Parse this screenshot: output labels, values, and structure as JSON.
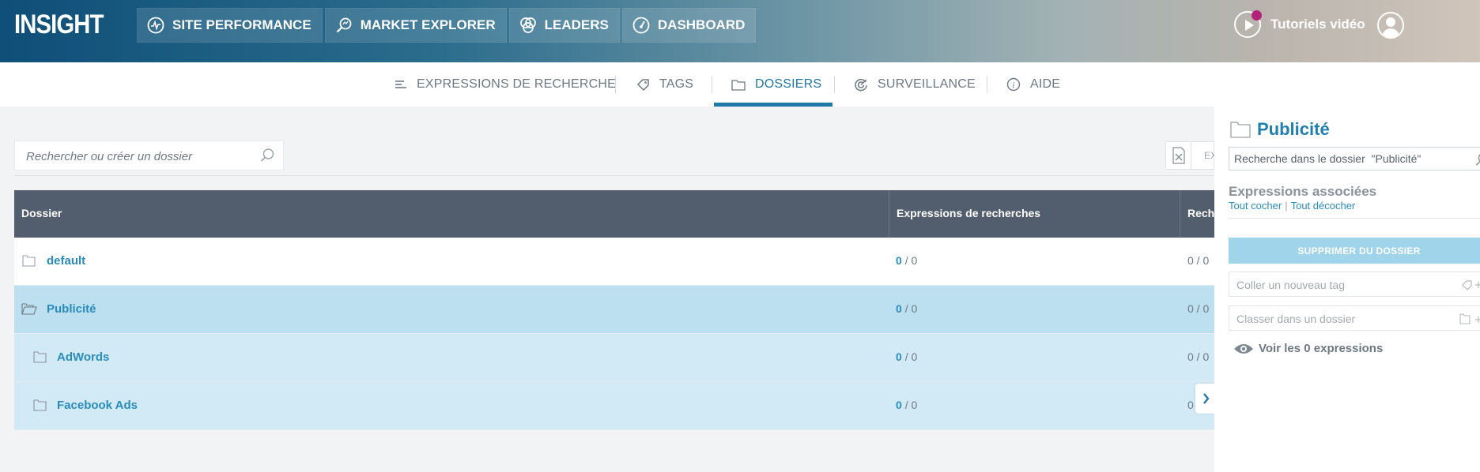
{
  "app": {
    "logo": "INSIGHT"
  },
  "main_nav": [
    {
      "label": "SITE PERFORMANCE",
      "icon": "activity-icon"
    },
    {
      "label": "MARKET EXPLORER",
      "icon": "search-magnifier-icon"
    },
    {
      "label": "LEADERS",
      "icon": "circles-icon"
    },
    {
      "label": "DASHBOARD",
      "icon": "gauge-icon"
    }
  ],
  "header_right": {
    "tutorials_label": "Tutoriels vidéo",
    "notification_color": "#b3227a"
  },
  "sub_nav": {
    "tabs": [
      {
        "label": "EXPRESSIONS DE RECHERCHE",
        "icon": "list-icon"
      },
      {
        "label": "TAGS",
        "icon": "tag-icon"
      },
      {
        "label": "DOSSIERS",
        "icon": "folder-icon",
        "active": true
      },
      {
        "label": "SURVEILLANCE",
        "icon": "radar-icon"
      },
      {
        "label": "AIDE",
        "icon": "info-icon"
      }
    ]
  },
  "search": {
    "placeholder": "Rechercher ou créer un dossier"
  },
  "toolbar": {
    "export_label": "EX"
  },
  "table": {
    "headers": [
      "Dossier",
      "Expressions de recherches",
      "Rech"
    ],
    "rows": [
      {
        "name": "default",
        "expr_sel": "0",
        "expr_total": "/ 0",
        "rech": "0 / 0",
        "state": "normal"
      },
      {
        "name": "Publicité",
        "expr_sel": "0",
        "expr_total": "/ 0",
        "rech": "0 / 0",
        "state": "selected"
      },
      {
        "name": "AdWords",
        "expr_sel": "0",
        "expr_total": "/ 0",
        "rech": "0 / 0",
        "state": "child"
      },
      {
        "name": "Facebook Ads",
        "expr_sel": "0",
        "expr_total": "/ 0",
        "rech": "0",
        "state": "child"
      }
    ]
  },
  "panel": {
    "title": "Publicité",
    "search_value": "Recherche dans le dossier  \"Publicité\"",
    "associated_heading": "Expressions associées",
    "check_all": "Tout cocher",
    "uncheck_all": "Tout décocher",
    "delete_button": "SUPPRIMER DU DOSSIER",
    "tag_placeholder": "Coller un nouveau tag",
    "folder_placeholder": "Classer dans un dossier",
    "view_expressions": "Voir les 0 expressions"
  },
  "colors": {
    "accent": "#1e78a8",
    "table_header": "#525e6d",
    "selected_row": "#bde0f0",
    "child_row": "#d2eaf5"
  }
}
